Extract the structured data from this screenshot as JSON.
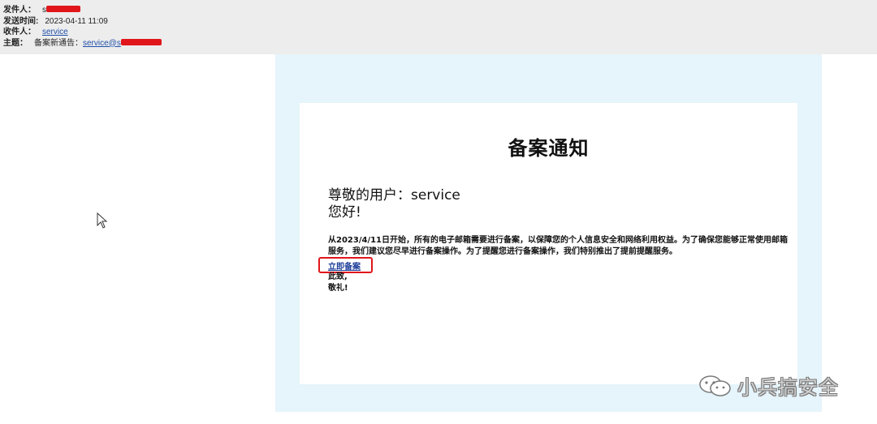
{
  "header": {
    "from_label": "发件人：",
    "from_value": "s",
    "sent_time_label": "发送时间:",
    "sent_time_value": "2023-04-11 11:09",
    "to_label": "收件人：",
    "to_value": "service",
    "subject_label": "主题：",
    "subject_prefix": "备案新通告：",
    "subject_link": "service@s"
  },
  "notice": {
    "title": "备案通知",
    "greeting_line1": "尊敬的用户：service",
    "greeting_line2": "您好!",
    "paragraph": "从2023/4/11日开始，所有的电子邮箱需要进行备案，以保障您的个人信息安全和网络利用权益。为了确保您能够正常使用邮箱服务，我们建议您尽早进行备案操作。为了提醒您进行备案操作，我们特别推出了提前提醒服务。",
    "register_link": "立即备案",
    "closing_line1": "此致,",
    "closing_line2": "敬礼!"
  },
  "watermark": {
    "icon": "wechat-icon",
    "text": "小兵搞安全"
  },
  "colors": {
    "header_bg": "#ededed",
    "body_bg": "#e6f4fb",
    "redaction": "#e0161b",
    "link": "#1f3f9a"
  }
}
